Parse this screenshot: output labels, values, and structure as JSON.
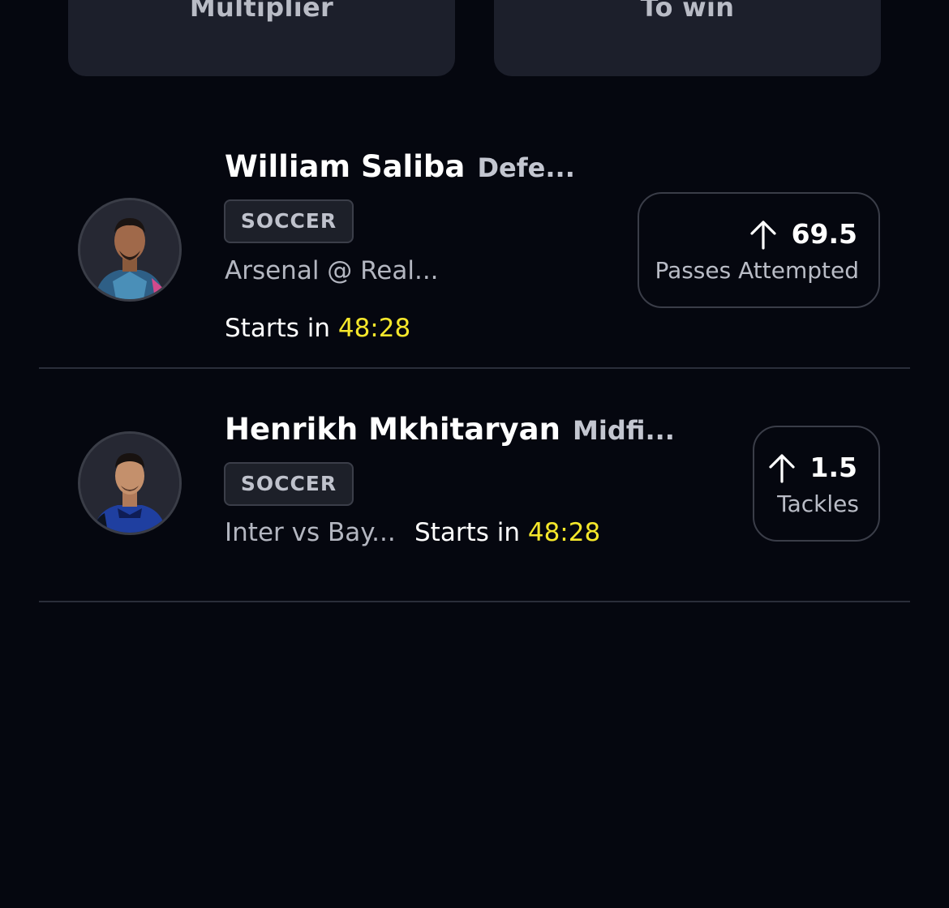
{
  "summary_cards": {
    "multiplier_label": "Multiplier",
    "to_win_label": "To win"
  },
  "picks": [
    {
      "player_name": "William Saliba",
      "position": "Defe...",
      "sport": "SOCCER",
      "matchup": "Arsenal @ Real...",
      "starts_label": "Starts in",
      "countdown": "48:28",
      "direction_icon": "arrow-up-icon",
      "line_value": "69.5",
      "stat": "Passes Attempted"
    },
    {
      "player_name": "Henrikh Mkhitaryan",
      "position": "Midfi...",
      "sport": "SOCCER",
      "matchup": "Inter vs Bay...",
      "starts_label": "Starts in",
      "countdown": "48:28",
      "direction_icon": "arrow-up-icon",
      "line_value": "1.5",
      "stat": "Tackles"
    }
  ],
  "colors": {
    "background": "#05070f",
    "card": "#1c1f2b",
    "countdown": "#f5e72b",
    "divider": "#2a2e3a"
  }
}
